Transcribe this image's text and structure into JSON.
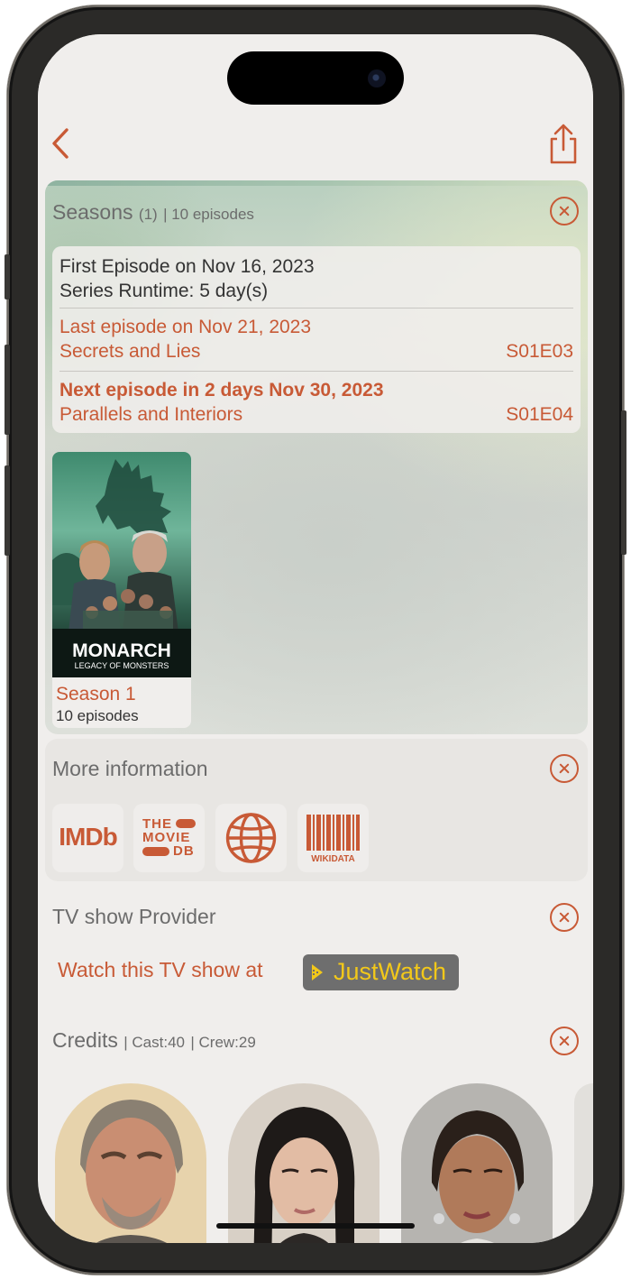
{
  "colors": {
    "accent": "#c85a36",
    "muted_text": "#6c6c6c",
    "justwatch_yellow": "#f2c81a"
  },
  "navbar": {
    "back_icon": "chevron-left-icon",
    "share_icon": "share-icon"
  },
  "seasons": {
    "title": "Seasons",
    "count": "(1)",
    "episodes_meta": "| 10 episodes",
    "first_episode": "First Episode on Nov 16, 2023",
    "series_runtime": "Series Runtime:  5 day(s)",
    "last_episode_label": "Last episode on Nov 21, 2023",
    "last_episode_title": "Secrets and Lies",
    "last_episode_code": "S01E03",
    "next_episode_label": "Next episode in 2 days Nov 30, 2023",
    "next_episode_title": "Parallels and Interiors",
    "next_episode_code": "S01E04",
    "tiles": [
      {
        "poster_title": "MONARCH",
        "poster_subtitle": "LEGACY OF MONSTERS",
        "label": "Season 1",
        "episodes": "10  episodes"
      }
    ]
  },
  "more_info": {
    "title": "More information",
    "links": [
      {
        "name": "imdb",
        "text": "IMDb"
      },
      {
        "name": "tmdb",
        "line1": "THE",
        "line2": "MOVIE",
        "line3": "DB"
      },
      {
        "name": "website",
        "icon": "globe-icon"
      },
      {
        "name": "wikidata",
        "text": "WIKIDATA"
      }
    ]
  },
  "provider": {
    "title": "TV show Provider",
    "watch_text": "Watch this TV show at",
    "provider_name": "JustWatch"
  },
  "credits": {
    "title": "Credits",
    "cast_meta": "| Cast:40",
    "crew_meta": "| Crew:29"
  }
}
